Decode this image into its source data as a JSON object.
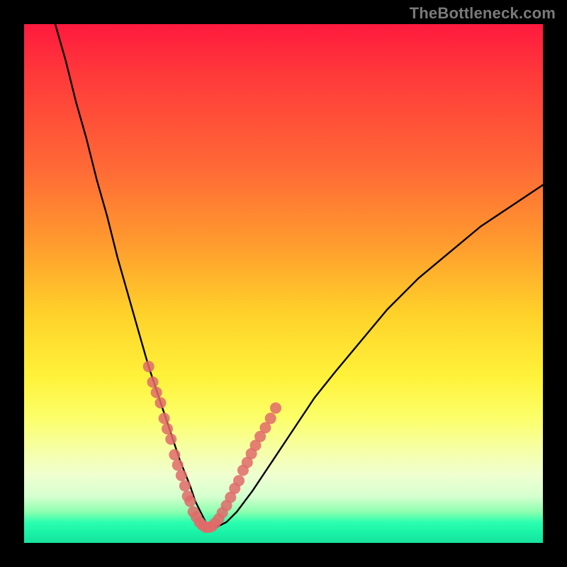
{
  "watermark": "TheBottleneck.com",
  "chart_data": {
    "type": "line",
    "title": "",
    "xlabel": "",
    "ylabel": "",
    "xlim": [
      0,
      100
    ],
    "ylim": [
      0,
      100
    ],
    "grid": false,
    "legend": false,
    "series": [
      {
        "name": "bottleneck-curve",
        "x": [
          6,
          8,
          10,
          12,
          14,
          16,
          18,
          20,
          22,
          24,
          26,
          28,
          30,
          32,
          33,
          34,
          35,
          36,
          37,
          39,
          41,
          44,
          48,
          52,
          56,
          60,
          65,
          70,
          76,
          82,
          88,
          94,
          100
        ],
        "y": [
          100,
          93,
          85,
          78,
          70,
          63,
          55,
          48,
          41,
          34,
          28,
          22,
          16,
          11,
          8,
          6,
          4,
          3,
          3,
          4,
          6,
          10,
          16,
          22,
          28,
          33,
          39,
          45,
          51,
          56,
          61,
          65,
          69
        ]
      }
    ],
    "markers": [
      {
        "name": "dense-points",
        "color": "#e06a6a",
        "x": [
          24.0,
          24.8,
          25.5,
          26.3,
          27.0,
          27.6,
          28.3,
          29.0,
          29.6,
          30.3,
          31.0,
          31.5,
          32.0,
          32.6,
          33.2,
          33.8,
          34.4,
          35.0,
          35.6,
          36.2,
          36.8,
          37.5,
          38.2,
          39.0,
          39.8,
          40.6,
          41.4,
          42.2,
          43.0,
          43.8,
          44.6,
          45.5,
          46.5,
          47.5,
          48.5
        ],
        "y": [
          34,
          31,
          29,
          27,
          24,
          22,
          20,
          17,
          15,
          13,
          11,
          9,
          8,
          6,
          5,
          4,
          3.4,
          3,
          3,
          3.2,
          3.8,
          4.6,
          5.8,
          7.2,
          8.8,
          10.5,
          12,
          14,
          15.5,
          17.2,
          18.8,
          20.5,
          22.2,
          24,
          26
        ]
      }
    ]
  }
}
